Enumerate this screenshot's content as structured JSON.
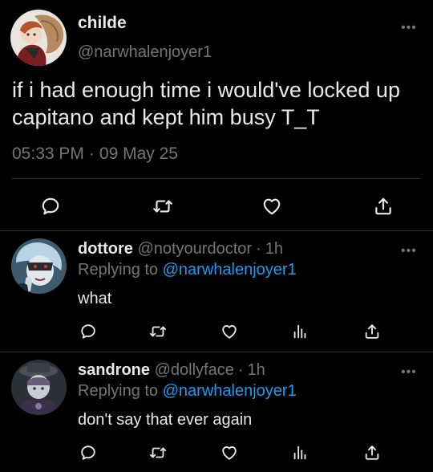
{
  "main_tweet": {
    "display_name": "childe",
    "handle": "@narwhalenjoyer1",
    "text": "if i had enough time i would've locked up capitano and kept him busy T_T",
    "time": "05:33 PM",
    "separator": "·",
    "date": "09 May 25",
    "avatar_icon": "avatar-childe",
    "more_icon": "more-icon"
  },
  "main_actions": [
    {
      "name": "reply-action",
      "icon": "reply-icon"
    },
    {
      "name": "retweet-action",
      "icon": "retweet-icon"
    },
    {
      "name": "like-action",
      "icon": "heart-icon"
    },
    {
      "name": "share-action",
      "icon": "share-icon"
    }
  ],
  "replies": [
    {
      "display_name": "dottore",
      "handle": "@notyourdoctor",
      "separator": "·",
      "age": "1h",
      "replying_prefix": "Replying to",
      "replying_to": "@narwhalenjoyer1",
      "text": "what",
      "avatar_icon": "avatar-dottore"
    },
    {
      "display_name": "sandrone",
      "handle": "@dollyface",
      "separator": "·",
      "age": "1h",
      "replying_prefix": "Replying to",
      "replying_to": "@narwhalenjoyer1",
      "text": "don't say that ever again",
      "avatar_icon": "avatar-sandrone"
    }
  ],
  "colors": {
    "background": "#000000",
    "text": "#e7e9ea",
    "secondary": "#71767b",
    "link": "#1d9bf0",
    "divider": "#2f3336"
  }
}
